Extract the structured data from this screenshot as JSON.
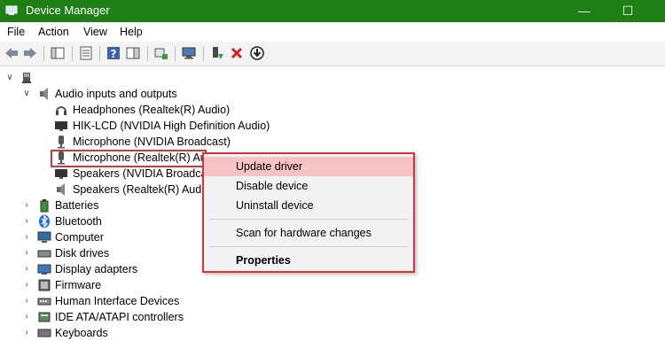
{
  "window": {
    "title": "Device Manager",
    "minimize": "—",
    "maximize": "☐",
    "accent": "#1e7f16"
  },
  "menu": [
    "File",
    "Action",
    "View",
    "Help"
  ],
  "tree": {
    "root_label": "",
    "audio_group": {
      "label": "Audio inputs and outputs",
      "children": [
        {
          "label": "Headphones (Realtek(R) Audio)",
          "icon": "headphones-icon"
        },
        {
          "label": "HIK-LCD (NVIDIA High Definition Audio)",
          "icon": "monitor-icon"
        },
        {
          "label": "Microphone (NVIDIA Broadcast)",
          "icon": "microphone-icon"
        },
        {
          "label": "Microphone (Realtek(R) Aud",
          "icon": "microphone-icon"
        },
        {
          "label": "Speakers (NVIDIA Broadcast",
          "icon": "monitor-icon"
        },
        {
          "label": "Speakers (Realtek(R) Audio)",
          "icon": "speaker-icon"
        }
      ]
    },
    "categories": [
      {
        "label": "Batteries",
        "icon": "battery-icon"
      },
      {
        "label": "Bluetooth",
        "icon": "bluetooth-icon"
      },
      {
        "label": "Computer",
        "icon": "computer-icon"
      },
      {
        "label": "Disk drives",
        "icon": "disk-drive-icon"
      },
      {
        "label": "Display adapters",
        "icon": "display-adapter-icon"
      },
      {
        "label": "Firmware",
        "icon": "firmware-icon"
      },
      {
        "label": "Human Interface Devices",
        "icon": "hid-icon"
      },
      {
        "label": "IDE ATA/ATAPI controllers",
        "icon": "ide-controller-icon"
      },
      {
        "label": "Keyboards",
        "icon": "keyboard-icon"
      }
    ]
  },
  "context_menu": {
    "items": [
      "Update driver",
      "Disable device",
      "Uninstall device",
      "Scan for hardware changes",
      "Properties"
    ],
    "hover_color": "#f7c3c5",
    "highlight_color": "#d0363c"
  }
}
